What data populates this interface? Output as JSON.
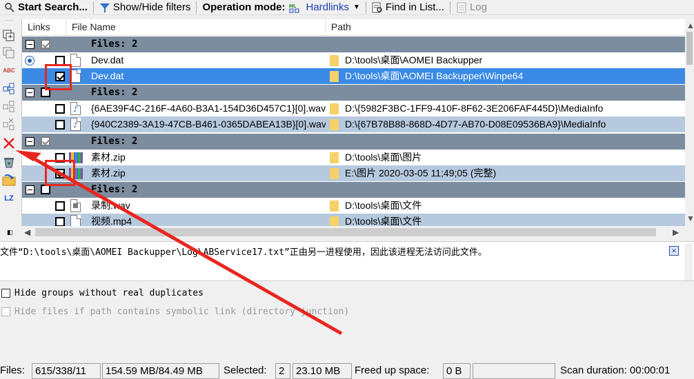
{
  "toolbar": {
    "start_search": "Start Search...",
    "show_hide_filters": "Show/Hide filters",
    "operation_mode_label": "Operation mode:",
    "operation_mode_value": "Hardlinks",
    "find_in_list": "Find in List...",
    "log": "Log"
  },
  "grid": {
    "headers": {
      "links": "Links",
      "file_name": "File Name",
      "path": "Path"
    },
    "groups": [
      {
        "title": "Files: 2",
        "files": [
          {
            "name": "Dev.dat",
            "path": "D:\\tools\\桌面\\AOMEI Backupper",
            "checked": false
          },
          {
            "name": "Dev.dat",
            "path": "D:\\tools\\桌面\\AOMEI Backupper\\Winpe64",
            "checked": true
          }
        ]
      },
      {
        "title": "Files: 2",
        "files": [
          {
            "name": "{6AE39F4C-216F-4A60-B3A1-154D36D457C1}[0].wav",
            "path": "D:\\{5982F3BC-1FF9-410F-8F62-3E206FAF445D}\\MediaInfo",
            "checked": false
          },
          {
            "name": "{940C2389-3A19-47CB-B461-0365DABEA13B}[0].wav",
            "path": "D:\\{67B78B88-868D-4D77-AB70-D08E09536BA9}\\MediaInfo",
            "checked": false
          }
        ]
      },
      {
        "title": "Files: 2",
        "files": [
          {
            "name": "素材.zip",
            "path": "D:\\tools\\桌面\\图片",
            "checked": false
          },
          {
            "name": "素材.zip",
            "path": "E:\\图片 2020-03-05 11;49;05 (完整)",
            "checked": true
          }
        ]
      },
      {
        "title": "Files: 2",
        "files": [
          {
            "name": "录制.wav",
            "path": "D:\\tools\\桌面\\文件",
            "checked": false
          },
          {
            "name": "视频.mp4",
            "path": "D:\\tools\\桌面\\文件",
            "checked": false
          }
        ]
      }
    ]
  },
  "message": "文件“D:\\tools\\桌面\\AOMEI Backupper\\Log\\ABService17.txt”正由另一进程使用，因此该进程无法访问此文件。",
  "options": {
    "hide_groups": "Hide groups without real duplicates",
    "hide_symbolic": "Hide files if path contains symbolic link (directory junction)"
  },
  "status": {
    "files_label": "Files:",
    "files_value": "615/338/11",
    "size_value": "154.59 MB/84.49 MB",
    "selected_label": "Selected:",
    "selected_count": "2",
    "selected_size": "23.10 MB",
    "freed_label": "Freed up space:",
    "freed_value": "0 B",
    "scan_label": "Scan duration: 00:00:01"
  },
  "left_tools": {
    "lz": "LZ",
    "abc": "ABC"
  },
  "colors": {
    "selected_row": "#3a8ae6",
    "group_row": "#7c8da0",
    "odd_row": "#b6c9de",
    "annotation": "#e8261f"
  }
}
